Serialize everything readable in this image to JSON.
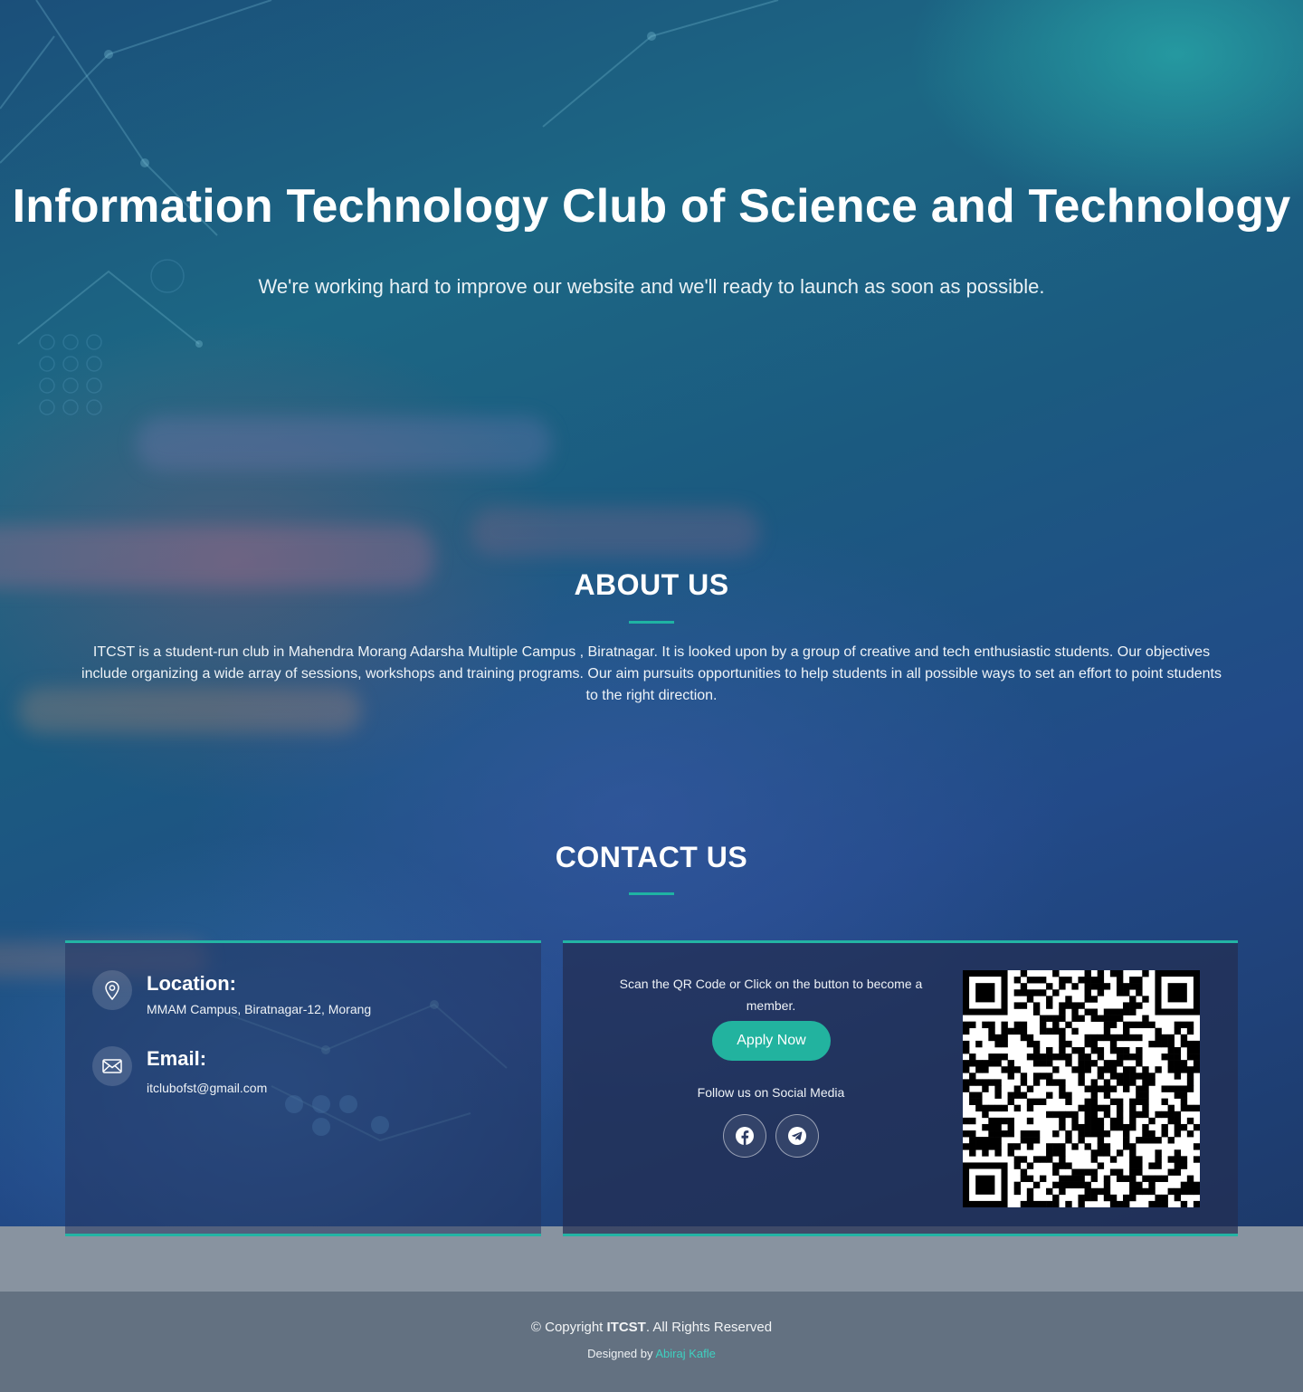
{
  "hero": {
    "title": "Information Technology Club of Science and Technology",
    "subtitle": "We're working hard to improve our website and we'll ready to launch as soon as possible."
  },
  "about": {
    "heading": "ABOUT US",
    "text": "ITCST is a student-run club in Mahendra Morang Adarsha Multiple Campus , Biratnagar. It is looked upon by a group of creative and tech enthusiastic students. Our objectives include organizing a wide array of sessions, workshops and training programs. Our aim pursuits opportunities to help students in all possible ways to set an effort to point students to the right direction."
  },
  "contact": {
    "heading": "CONTACT US",
    "location": {
      "label": "Location:",
      "value": "MMAM Campus, Biratnagar-12, Morang",
      "icon": "map-pin-icon"
    },
    "email": {
      "label": "Email:",
      "value": "itclubofst@gmail.com",
      "icon": "envelope-icon"
    },
    "scan_text": "Scan the QR Code or Click on the button to become a member.",
    "apply_label": "Apply Now",
    "follow_text": "Follow us on Social Media",
    "socials": [
      {
        "name": "facebook",
        "icon": "facebook-icon"
      },
      {
        "name": "telegram",
        "icon": "telegram-icon"
      }
    ]
  },
  "footer": {
    "copyright_prefix": "© Copyright ",
    "brand": "ITCST",
    "copyright_suffix": ". All Rights Reserved",
    "designed_by": "Designed by ",
    "designer": "Abiraj Kafle"
  },
  "colors": {
    "accent": "#22b39f",
    "footer_bg": "#637181",
    "band_bg": "#8893a0",
    "link": "#3ed0c0"
  }
}
